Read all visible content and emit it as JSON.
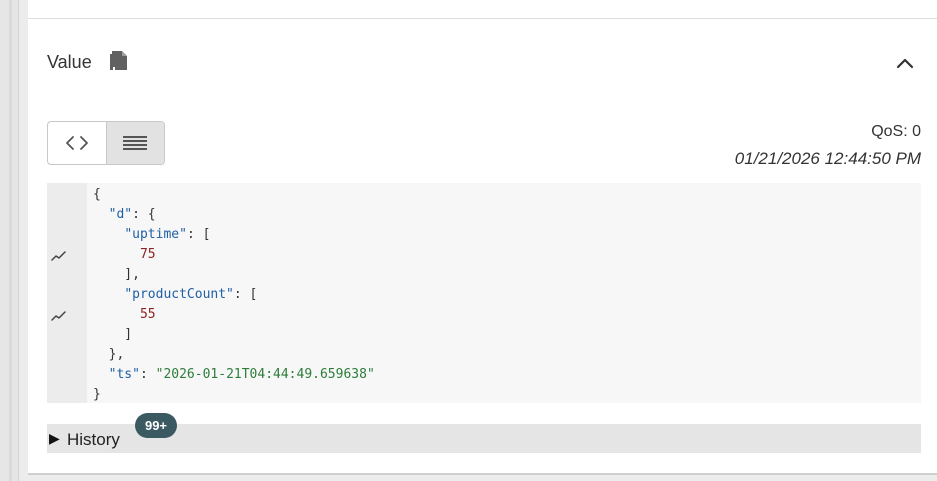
{
  "value_panel": {
    "title": "Value",
    "qos": "QoS: 0",
    "timestamp": "01/21/2026 12:44:50 PM",
    "view_modes": [
      "code-icon",
      "list-icon"
    ],
    "active_view": "list-icon"
  },
  "payload": {
    "lines": [
      {
        "parts": [
          {
            "text": "{",
            "kind": "plain"
          }
        ]
      },
      {
        "parts": [
          {
            "text": "  ",
            "kind": "plain"
          },
          {
            "text": "\"d\"",
            "kind": "key"
          },
          {
            "text": ": {",
            "kind": "plain"
          }
        ]
      },
      {
        "parts": [
          {
            "text": "    ",
            "kind": "plain"
          },
          {
            "text": "\"uptime\"",
            "kind": "key"
          },
          {
            "text": ": [",
            "kind": "plain"
          }
        ]
      },
      {
        "parts": [
          {
            "text": "      ",
            "kind": "plain"
          },
          {
            "text": "75",
            "kind": "num"
          }
        ],
        "chart_icon": true
      },
      {
        "parts": [
          {
            "text": "    ],",
            "kind": "plain"
          }
        ]
      },
      {
        "parts": [
          {
            "text": "    ",
            "kind": "plain"
          },
          {
            "text": "\"productCount\"",
            "kind": "key"
          },
          {
            "text": ": [",
            "kind": "plain"
          }
        ]
      },
      {
        "parts": [
          {
            "text": "      ",
            "kind": "plain"
          },
          {
            "text": "55",
            "kind": "num"
          }
        ],
        "chart_icon": true
      },
      {
        "parts": [
          {
            "text": "    ]",
            "kind": "plain"
          }
        ]
      },
      {
        "parts": [
          {
            "text": "  },",
            "kind": "plain"
          }
        ]
      },
      {
        "parts": [
          {
            "text": "  ",
            "kind": "plain"
          },
          {
            "text": "\"ts\"",
            "kind": "key"
          },
          {
            "text": ": ",
            "kind": "plain"
          },
          {
            "text": "\"2026-01-21T04:44:49.659638\"",
            "kind": "str"
          }
        ]
      },
      {
        "parts": [
          {
            "text": "}",
            "kind": "plain"
          }
        ]
      }
    ]
  },
  "history": {
    "label": "History",
    "badge": "99+"
  },
  "colors": {
    "badge_bg": "#3a5961",
    "json_key": "#1f5fa6",
    "json_string": "#2d7d3a",
    "json_number": "#8a2424"
  }
}
